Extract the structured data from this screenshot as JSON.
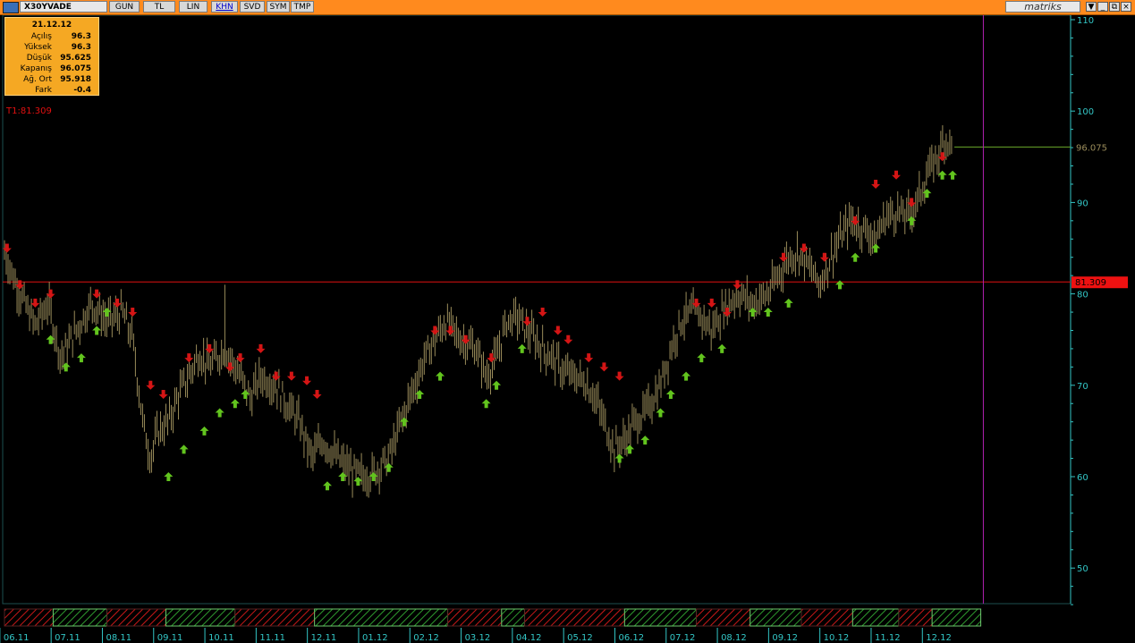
{
  "toolbar": {
    "symbol": "X30YVADE",
    "buttons": [
      "GUN",
      "TL",
      "LIN",
      "KHN",
      "SVD",
      "SYM",
      "TMP"
    ],
    "active": "KHN",
    "logo": "matriks",
    "window_controls": [
      "▼",
      "_",
      "⧉",
      "×"
    ]
  },
  "info_box": {
    "date": "21.12.12",
    "rows": [
      {
        "label": "Açılış",
        "value": "96.3"
      },
      {
        "label": "Yüksek",
        "value": "96.3"
      },
      {
        "label": "Düşük",
        "value": "95.625"
      },
      {
        "label": "Kapanış",
        "value": "96.075"
      },
      {
        "label": "Ağ. Ort",
        "value": "95.918"
      },
      {
        "label": "Fark",
        "value": "-0.4"
      }
    ]
  },
  "colors": {
    "background": "#000000",
    "price": "#9a8c5a",
    "buy_signal": "#62c41e",
    "sell_signal": "#d41515",
    "level_line": "#e01010",
    "axis": "#33c6c6",
    "cursor": "#b020b0",
    "toolbar": "#ff8a1e"
  },
  "chart_data": {
    "type": "line",
    "ylim": [
      45,
      111
    ],
    "y_ticks": [
      50,
      60,
      70,
      80,
      90,
      100,
      110
    ],
    "x_ticks": [
      "06.11",
      "07.11",
      "08.11",
      "09.11",
      "10.11",
      "11.11",
      "12.11",
      "01.12",
      "02.12",
      "03.12",
      "04.12",
      "05.12",
      "06.12",
      "07.12",
      "08.12",
      "09.12",
      "10.12",
      "11.12",
      "12.12"
    ],
    "trend_line": {
      "label": "T1:81.309",
      "value": 81.309,
      "tag": "81.309"
    },
    "last_price_label": "96.075",
    "series": [
      {
        "values": [
          [
            0,
            84.5
          ],
          [
            0.3,
            80
          ],
          [
            0.6,
            76.5
          ],
          [
            0.85,
            79
          ],
          [
            1.1,
            73
          ],
          [
            1.4,
            76
          ],
          [
            1.7,
            79
          ],
          [
            2.0,
            77
          ],
          [
            2.3,
            78
          ],
          [
            2.5,
            75
          ],
          [
            2.7,
            66
          ],
          [
            2.85,
            62
          ],
          [
            3.0,
            65
          ],
          [
            3.2,
            66
          ],
          [
            3.4,
            69
          ],
          [
            3.6,
            71
          ],
          [
            3.8,
            73.5
          ],
          [
            4.0,
            72
          ],
          [
            4.3,
            74
          ],
          [
            4.6,
            71
          ],
          [
            4.8,
            68.5
          ],
          [
            5.0,
            71
          ],
          [
            5.3,
            70
          ],
          [
            5.5,
            68
          ],
          [
            5.75,
            66
          ],
          [
            6.0,
            62
          ],
          [
            6.2,
            64
          ],
          [
            6.5,
            62
          ],
          [
            6.8,
            60.5
          ],
          [
            7.0,
            60
          ],
          [
            7.2,
            60.5
          ],
          [
            7.5,
            62
          ],
          [
            7.8,
            67
          ],
          [
            8.0,
            70
          ],
          [
            8.2,
            73
          ],
          [
            8.4,
            75
          ],
          [
            8.6,
            77
          ],
          [
            8.9,
            75
          ],
          [
            9.2,
            74
          ],
          [
            9.4,
            71
          ],
          [
            9.6,
            73
          ],
          [
            9.8,
            77
          ],
          [
            10.0,
            77.5
          ],
          [
            10.2,
            76
          ],
          [
            10.5,
            74
          ],
          [
            10.7,
            73
          ],
          [
            10.9,
            71.5
          ],
          [
            11.1,
            71
          ],
          [
            11.3,
            70.5
          ],
          [
            11.5,
            69
          ],
          [
            11.7,
            66
          ],
          [
            11.9,
            63
          ],
          [
            12.1,
            64
          ],
          [
            12.3,
            66
          ],
          [
            12.5,
            67
          ],
          [
            12.8,
            70
          ],
          [
            13.0,
            74
          ],
          [
            13.2,
            77
          ],
          [
            13.4,
            78
          ],
          [
            13.6,
            77.5
          ],
          [
            13.8,
            76
          ],
          [
            14.0,
            78
          ],
          [
            14.3,
            80
          ],
          [
            14.6,
            79
          ],
          [
            14.9,
            80
          ],
          [
            15.1,
            82
          ],
          [
            15.3,
            84
          ],
          [
            15.5,
            84.5
          ],
          [
            15.7,
            83
          ],
          [
            15.9,
            81
          ],
          [
            16.2,
            85
          ],
          [
            16.5,
            88
          ],
          [
            16.8,
            87
          ],
          [
            17.0,
            86
          ],
          [
            17.2,
            88.5
          ],
          [
            17.4,
            89
          ],
          [
            17.6,
            88.5
          ],
          [
            17.8,
            90
          ],
          [
            18.0,
            93
          ],
          [
            18.2,
            95
          ],
          [
            18.35,
            97
          ],
          [
            18.5,
            96.1
          ]
        ]
      }
    ],
    "buy_signals": [
      [
        0.9,
        75
      ],
      [
        1.2,
        72
      ],
      [
        1.5,
        73
      ],
      [
        1.8,
        76
      ],
      [
        2.0,
        78
      ],
      [
        3.2,
        60
      ],
      [
        3.5,
        63
      ],
      [
        3.9,
        65
      ],
      [
        4.2,
        67
      ],
      [
        4.5,
        68
      ],
      [
        4.7,
        69
      ],
      [
        6.3,
        59
      ],
      [
        6.6,
        60
      ],
      [
        6.9,
        59.5
      ],
      [
        7.2,
        60
      ],
      [
        7.5,
        61
      ],
      [
        7.8,
        66
      ],
      [
        8.1,
        69
      ],
      [
        8.5,
        71
      ],
      [
        9.4,
        68
      ],
      [
        9.6,
        70
      ],
      [
        10.1,
        74
      ],
      [
        12.0,
        62
      ],
      [
        12.2,
        63
      ],
      [
        12.5,
        64
      ],
      [
        12.8,
        67
      ],
      [
        13.0,
        69
      ],
      [
        13.3,
        71
      ],
      [
        13.6,
        73
      ],
      [
        14.0,
        74
      ],
      [
        14.6,
        78
      ],
      [
        14.9,
        78
      ],
      [
        15.3,
        79
      ],
      [
        16.3,
        81
      ],
      [
        16.6,
        84
      ],
      [
        17.0,
        85
      ],
      [
        17.7,
        88
      ],
      [
        18.0,
        91
      ],
      [
        18.3,
        93
      ],
      [
        18.5,
        93
      ]
    ],
    "sell_signals": [
      [
        0.05,
        85
      ],
      [
        0.3,
        81
      ],
      [
        0.6,
        79
      ],
      [
        0.9,
        80
      ],
      [
        1.8,
        80
      ],
      [
        2.2,
        79
      ],
      [
        2.5,
        78
      ],
      [
        2.85,
        70
      ],
      [
        3.1,
        69
      ],
      [
        3.6,
        73
      ],
      [
        4.0,
        74
      ],
      [
        4.4,
        72
      ],
      [
        4.6,
        73
      ],
      [
        5.0,
        74
      ],
      [
        5.3,
        71
      ],
      [
        5.6,
        71
      ],
      [
        5.9,
        70.5
      ],
      [
        6.1,
        69
      ],
      [
        8.4,
        76
      ],
      [
        8.7,
        76
      ],
      [
        9.0,
        75
      ],
      [
        9.5,
        73
      ],
      [
        10.2,
        77
      ],
      [
        10.5,
        78
      ],
      [
        10.8,
        76
      ],
      [
        11.0,
        75
      ],
      [
        11.4,
        73
      ],
      [
        11.7,
        72
      ],
      [
        12.0,
        71
      ],
      [
        13.5,
        79
      ],
      [
        13.8,
        79
      ],
      [
        14.1,
        78
      ],
      [
        14.3,
        81
      ],
      [
        15.2,
        84
      ],
      [
        15.6,
        85
      ],
      [
        16.0,
        84
      ],
      [
        16.6,
        88
      ],
      [
        17.0,
        92
      ],
      [
        17.4,
        93
      ],
      [
        17.7,
        90
      ],
      [
        18.3,
        95
      ]
    ],
    "segments": [
      {
        "from": 0,
        "to": 0.95,
        "color": "red"
      },
      {
        "from": 0.95,
        "to": 2.0,
        "color": "green"
      },
      {
        "from": 2.0,
        "to": 3.15,
        "color": "red"
      },
      {
        "from": 3.15,
        "to": 4.5,
        "color": "green"
      },
      {
        "from": 4.5,
        "to": 6.05,
        "color": "red"
      },
      {
        "from": 6.05,
        "to": 8.65,
        "color": "green"
      },
      {
        "from": 8.65,
        "to": 9.7,
        "color": "red"
      },
      {
        "from": 9.7,
        "to": 10.15,
        "color": "green"
      },
      {
        "from": 10.15,
        "to": 12.1,
        "color": "red"
      },
      {
        "from": 12.1,
        "to": 13.5,
        "color": "green"
      },
      {
        "from": 13.5,
        "to": 14.55,
        "color": "red"
      },
      {
        "from": 14.55,
        "to": 15.55,
        "color": "green"
      },
      {
        "from": 15.55,
        "to": 16.55,
        "color": "red"
      },
      {
        "from": 16.55,
        "to": 17.45,
        "color": "green"
      },
      {
        "from": 17.45,
        "to": 18.1,
        "color": "red"
      },
      {
        "from": 18.1,
        "to": 19.05,
        "color": "green"
      }
    ],
    "cursor_x": 19.1
  }
}
